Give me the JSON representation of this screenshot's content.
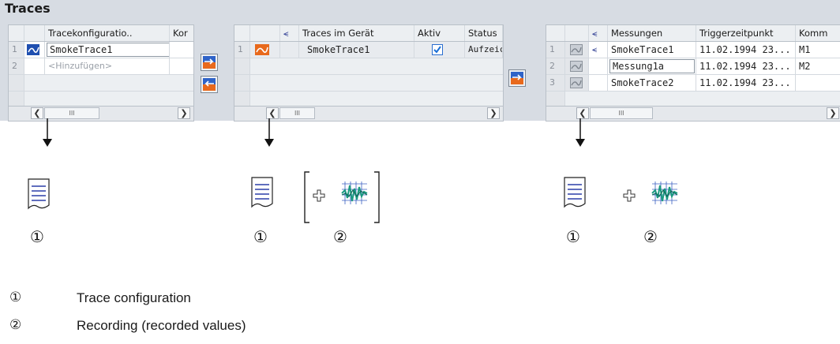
{
  "window": {
    "title": "Traces"
  },
  "panel1": {
    "headers": [
      "Tracekonfiguratio..",
      "Kor"
    ],
    "rows": [
      {
        "num": "1",
        "name": "SmokeTrace1"
      },
      {
        "num": "2",
        "name": "<Hinzufügen>"
      }
    ],
    "scroll_thumb": "III"
  },
  "panel2": {
    "headers": [
      "Traces im Gerät",
      "Aktiv",
      "Status"
    ],
    "rows": [
      {
        "num": "1",
        "name": "SmokeTrace1",
        "active": true,
        "status": "Aufzeic"
      }
    ],
    "scroll_thumb": "III"
  },
  "panel3": {
    "headers": [
      "Messungen",
      "Triggerzeitpunkt",
      "Komm"
    ],
    "rows": [
      {
        "num": "1",
        "name": "SmokeTrace1",
        "time": "11.02.1994 23...",
        "comment": "M1"
      },
      {
        "num": "2",
        "name": "Messung1a",
        "time": "11.02.1994 23...",
        "comment": "M2"
      },
      {
        "num": "3",
        "name": "SmokeTrace2",
        "time": "11.02.1994 23...",
        "comment": ""
      }
    ],
    "scroll_thumb": "III"
  },
  "markers": {
    "one": "①",
    "two": "②"
  },
  "legend": {
    "item1_marker": "①",
    "item1_text": "Trace configuration",
    "item2_marker": "②",
    "item2_text": "Recording (recorded values)"
  },
  "icons": [
    "trace-config-icon",
    "transfer-to-device-icon",
    "transfer-from-device-icon",
    "save-measurement-icon",
    "document-icon",
    "recording-icon",
    "plus-icon"
  ],
  "colors": {
    "accent_blue": "#1f4fb0",
    "accent_orange": "#e8691c",
    "ui_gray": "#d7dce3",
    "check": "#1a6fd6"
  }
}
